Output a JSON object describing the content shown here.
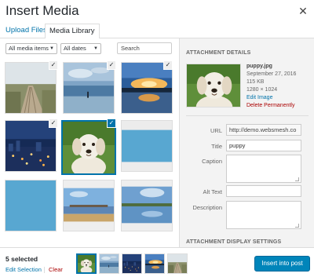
{
  "modal": {
    "title": "Insert Media",
    "close_icon": "close-icon"
  },
  "tabs": [
    {
      "label": "Upload Files"
    },
    {
      "label": "Media Library"
    }
  ],
  "filters": {
    "type_selected": "All media items",
    "date_selected": "All dates",
    "search_placeholder": "Search"
  },
  "grid": {
    "items": [
      {
        "name": "boardwalk",
        "selected": true,
        "active": false
      },
      {
        "name": "sea",
        "selected": true,
        "active": false
      },
      {
        "name": "sunset",
        "selected": true,
        "active": false
      },
      {
        "name": "city",
        "selected": true,
        "active": false
      },
      {
        "name": "puppy",
        "selected": true,
        "active": true
      },
      {
        "name": "blue-image",
        "selected": false,
        "active": false
      },
      {
        "name": "blue-square",
        "selected": false,
        "active": false
      },
      {
        "name": "pier",
        "selected": false,
        "active": false
      },
      {
        "name": "lake",
        "selected": false,
        "active": false
      }
    ],
    "check_glyph": "✓"
  },
  "details": {
    "heading": "ATTACHMENT DETAILS",
    "filename": "puppy.jpg",
    "date": "September 27, 2016",
    "size": "115 KB",
    "dimensions": "1280 × 1024",
    "edit_link": "Edit Image",
    "delete_link": "Delete Permanently",
    "fields": {
      "url_label": "URL",
      "url_value": "http://demo.websmesh.co",
      "title_label": "Title",
      "title_value": "puppy",
      "caption_label": "Caption",
      "alt_label": "Alt Text",
      "description_label": "Description"
    },
    "display_heading": "ATTACHMENT DISPLAY SETTINGS"
  },
  "toolbar": {
    "count": "5 selected",
    "edit_selection": "Edit Selection",
    "clear": "Clear",
    "insert_label": "Insert into post"
  },
  "colors": {
    "accent": "#0073aa",
    "button": "#0085ba",
    "delete": "#a00000"
  }
}
